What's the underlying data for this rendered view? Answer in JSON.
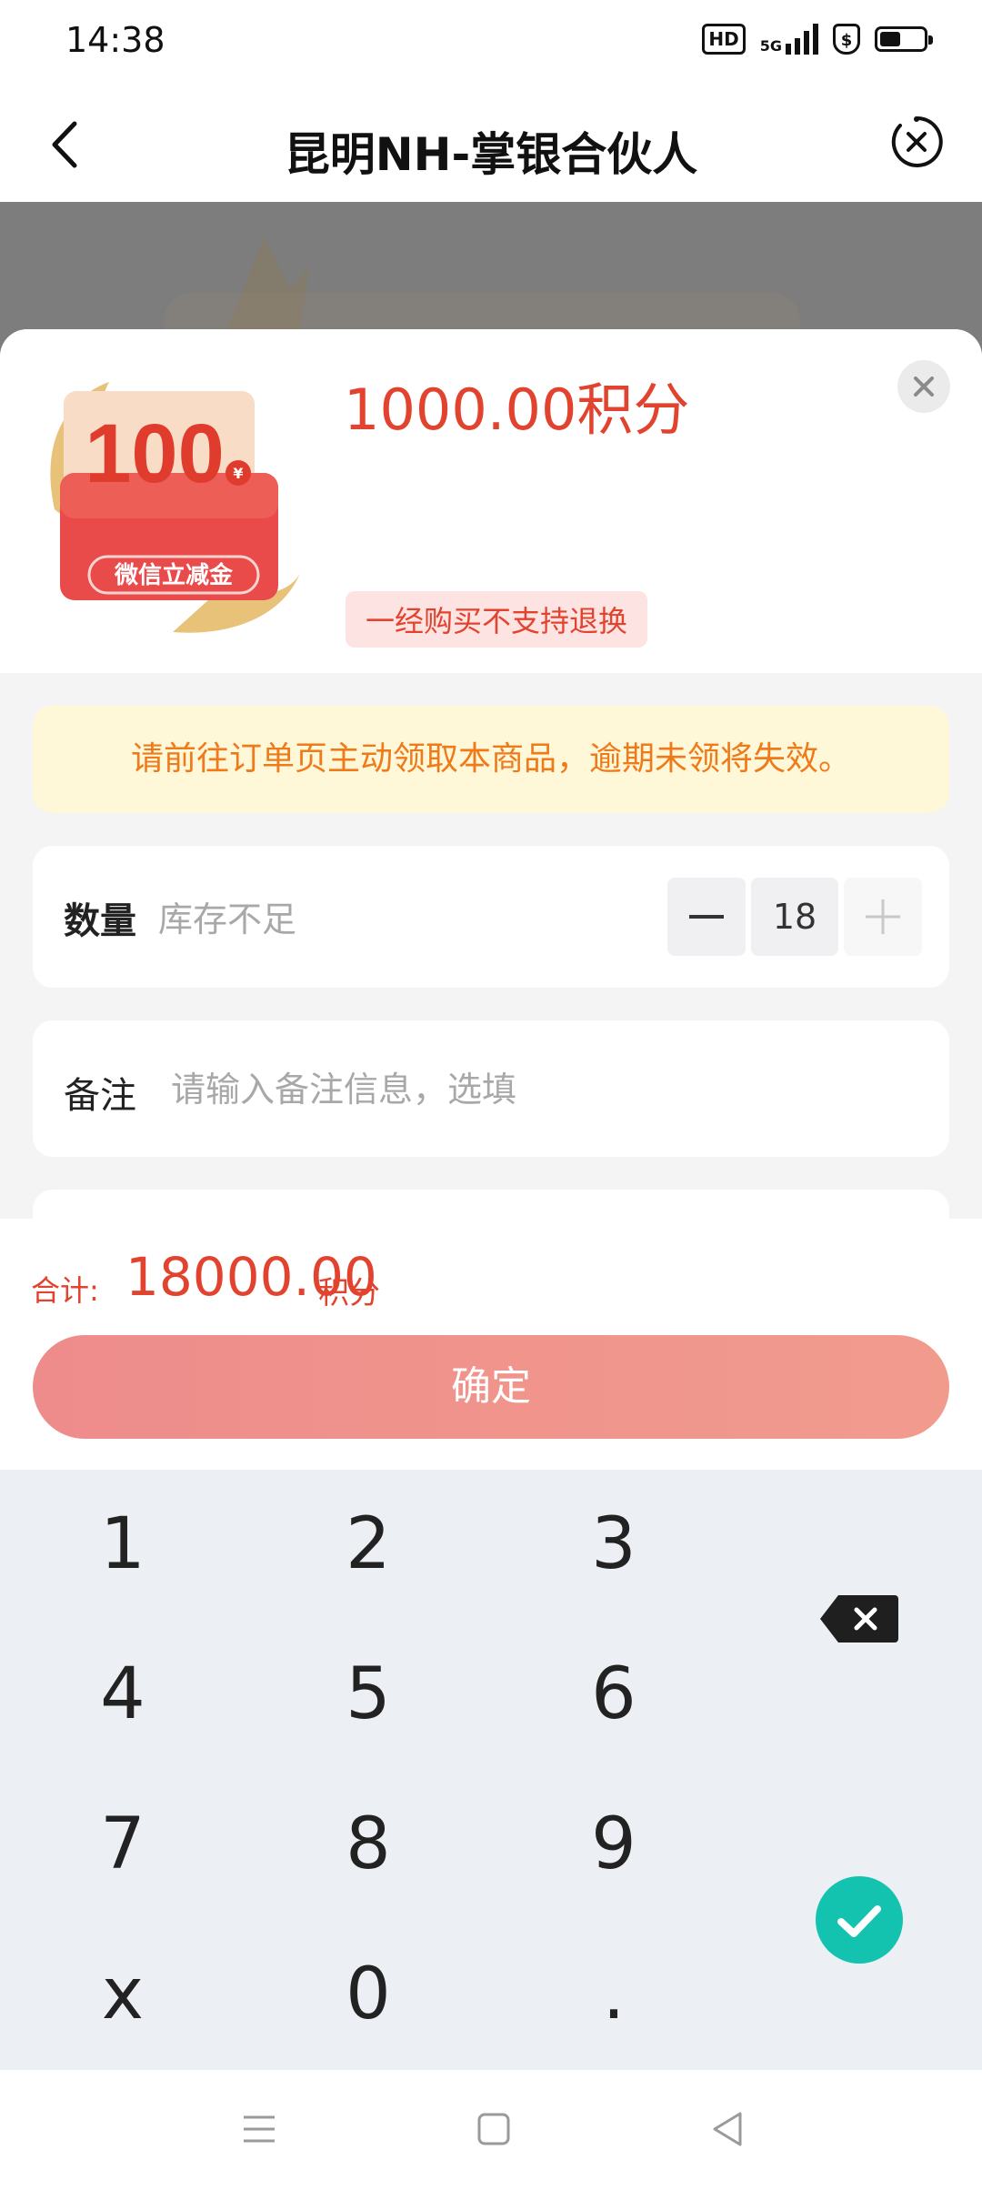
{
  "status_bar": {
    "time": "14:38",
    "hd_badge": "HD",
    "network": "5G",
    "battery_level": 0.45
  },
  "nav": {
    "title": "昆明NH-掌银合伙人",
    "back_icon": "chevron-left-icon",
    "close_icon": "close-circle-icon"
  },
  "product": {
    "image_number": "100",
    "image_caption": "微信立减金",
    "image_currency": "¥",
    "price": "1000.00积分",
    "tag": "一经购买不支持退换"
  },
  "notice": "请前往订单页主动领取本商品，逾期未领将失效。",
  "quantity": {
    "label": "数量",
    "stock_status": "库存不足",
    "value": "18",
    "minus_symbol": "—",
    "plus_symbol": "+"
  },
  "remark": {
    "label": "备注",
    "placeholder": "请输入备注信息，选填",
    "value": ""
  },
  "total": {
    "label": "合计:",
    "value": "18000.00",
    "unit": "积分"
  },
  "confirm_label": "确定",
  "keypad": {
    "keys": [
      "1",
      "2",
      "3",
      "4",
      "5",
      "6",
      "7",
      "8",
      "9",
      "x",
      "0",
      "."
    ]
  },
  "colors": {
    "accent_red": "#e2432f",
    "confirm_gradient_start": "#ee8c8c",
    "notice_bg": "#fef7d8",
    "notice_text": "#ef7a1a",
    "keypad_confirm": "#14c2b0"
  }
}
